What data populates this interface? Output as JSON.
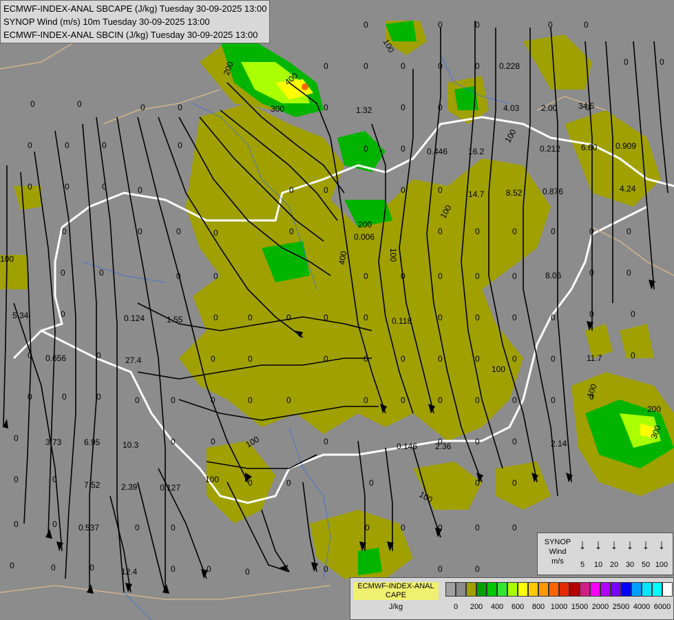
{
  "header": {
    "line1": "ECMWF-INDEX-ANAL SBCAPE (J/kg) Tuesday 30-09-2025 13:00",
    "line2": "SYNOP Wind (m/s) 10m Tuesday 30-09-2025 13:00",
    "line3": "ECMWF-INDEX-ANAL SBCIN (J/kg) Tuesday 30-09-2025 13:00"
  },
  "map_labels": {
    "cin_values": [
      "0.228",
      "1.32",
      "4.03",
      "2.00",
      "34.5",
      "0.446",
      "16.2",
      "0.212",
      "6.60",
      "0.909",
      "14.7",
      "8.52",
      "0.876",
      "4.24",
      "0.006",
      "0.118",
      "5.34",
      "0.124",
      "1.55",
      "8.06",
      "0.656",
      "27.4",
      "11.7",
      "3.73",
      "6.95",
      "10.3",
      "2.14",
      "0.146",
      "2.36",
      "7.52",
      "2.39",
      "0.127",
      "0.537",
      "12.4"
    ],
    "cape_contours": [
      "100",
      "200",
      "400",
      "300",
      "200",
      "400",
      "100",
      "100",
      "100",
      "100",
      "100",
      "200",
      "300",
      "100",
      "100",
      "100",
      "100"
    ]
  },
  "wind_legend": {
    "title_line1": "SYNOP",
    "title_line2": "Wind",
    "title_line3": "m/s",
    "items": [
      "5",
      "10",
      "20",
      "30",
      "50",
      "100"
    ]
  },
  "cape_legend": {
    "title_line1": "ECMWF-INDEX-ANAL",
    "title_line2": "CAPE",
    "title_line3": "J/kg",
    "colors": [
      "#a0a0a0",
      "#8c8c8c",
      "#a0a000",
      "#00a000",
      "#00c800",
      "#32e632",
      "#aaff00",
      "#ffff00",
      "#ffc800",
      "#ff9600",
      "#ff6400",
      "#e62800",
      "#b40000",
      "#d21e82",
      "#ff00ff",
      "#b400ff",
      "#7800ff",
      "#0000ff",
      "#00a0ff",
      "#00e6ff",
      "#00ffff",
      "#ffffff"
    ],
    "labels": [
      "0",
      "200",
      "400",
      "600",
      "800",
      "1000",
      "1500",
      "2000",
      "2500",
      "4000",
      "6000"
    ]
  }
}
